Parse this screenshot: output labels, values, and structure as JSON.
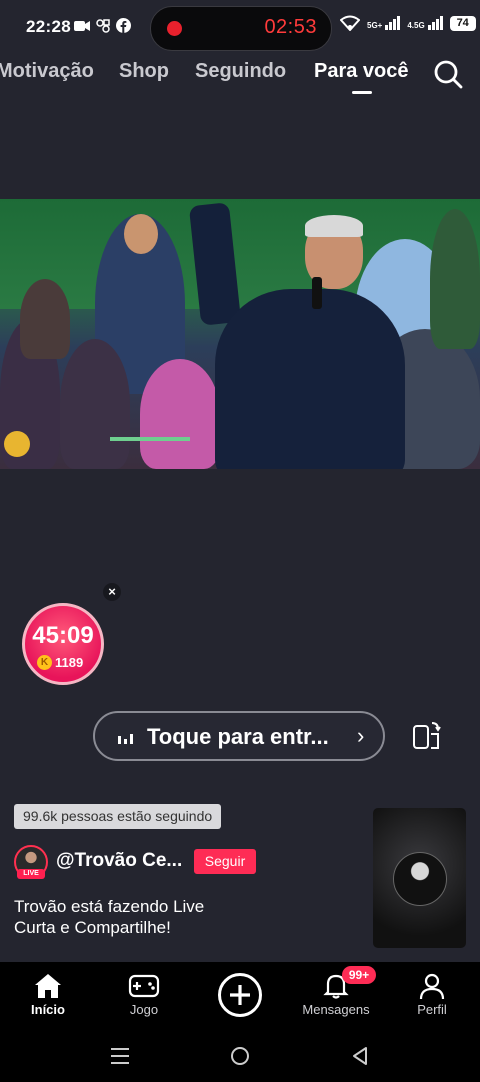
{
  "status_bar": {
    "time": "22:28",
    "record_timer": "02:53",
    "net1": "5G+",
    "net2": "4.5G",
    "battery": "74"
  },
  "top_tabs": [
    {
      "label": "Motivação",
      "active": false
    },
    {
      "label": "Shop",
      "active": false
    },
    {
      "label": "Seguindo",
      "active": false
    },
    {
      "label": "Para você",
      "active": true
    }
  ],
  "live": {
    "timer": "45:09",
    "coins": "1189",
    "close": "×",
    "enter_label": "Toque para entr...",
    "followers_text": "99.6k pessoas estão seguindo",
    "username": "@Trovão Ce...",
    "follow_label": "Seguir",
    "live_tag": "LIVE",
    "caption_line1": "Trovão está fazendo Live",
    "caption_line2": "Curta e Compartilhe!"
  },
  "bottom_nav": {
    "home": "Início",
    "game": "Jogo",
    "messages": "Mensagens",
    "messages_badge": "99+",
    "profile": "Perfil"
  },
  "colors": {
    "accent": "#fe2c55",
    "background": "#24252f"
  }
}
